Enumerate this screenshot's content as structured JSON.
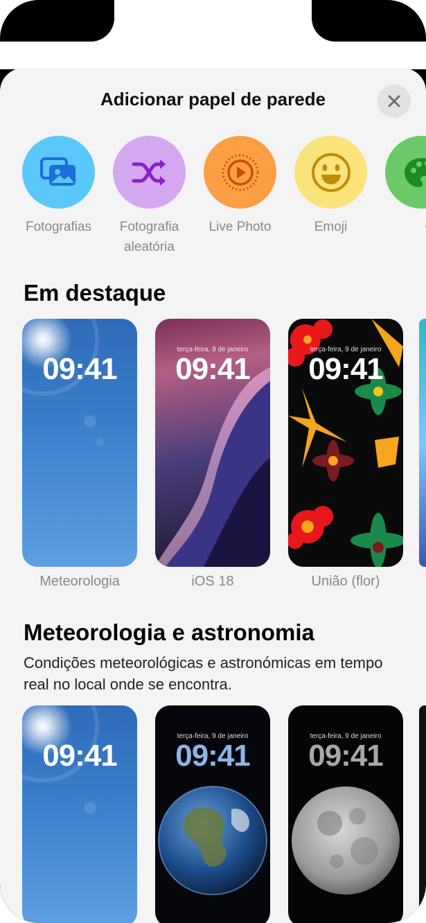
{
  "sheet": {
    "title": "Adicionar papel de parede"
  },
  "categories": [
    {
      "label": "Fotografias",
      "icon": "photos-icon",
      "color": "#5ac8fa"
    },
    {
      "label": "Fotografia aleatória",
      "icon": "shuffle-icon",
      "color": "#d4a8f0"
    },
    {
      "label": "Live Photo",
      "icon": "live-photo-icon",
      "color": "#ff9f45"
    },
    {
      "label": "Emoji",
      "icon": "emoji-icon",
      "color": "#fbe37c"
    },
    {
      "label": "Co",
      "icon": "palette-icon",
      "color": "#6cc96a"
    }
  ],
  "featured": {
    "title": "Em destaque",
    "items": [
      {
        "label": "Meteorologia",
        "time": "09:41",
        "date": ""
      },
      {
        "label": "iOS 18",
        "time": "09:41",
        "date": "terça-feira, 9 de janeiro"
      },
      {
        "label": "União (flor)",
        "time": "09:41",
        "date": "terça-feira, 9 de janeiro"
      }
    ]
  },
  "weather_astro": {
    "title": "Meteorologia e astronomia",
    "subtitle": "Condições meteorológicas e astronómicas em tempo real no local onde se encontra.",
    "items": [
      {
        "time": "09:41",
        "date": ""
      },
      {
        "time": "09:41",
        "date": "terça-feira, 9 de janeiro"
      },
      {
        "time": "09:41",
        "date": "terça-feira, 9 de janeiro"
      }
    ]
  },
  "colors": {
    "accent_sheet": "#f4f4f5",
    "muted_label": "#888888"
  }
}
